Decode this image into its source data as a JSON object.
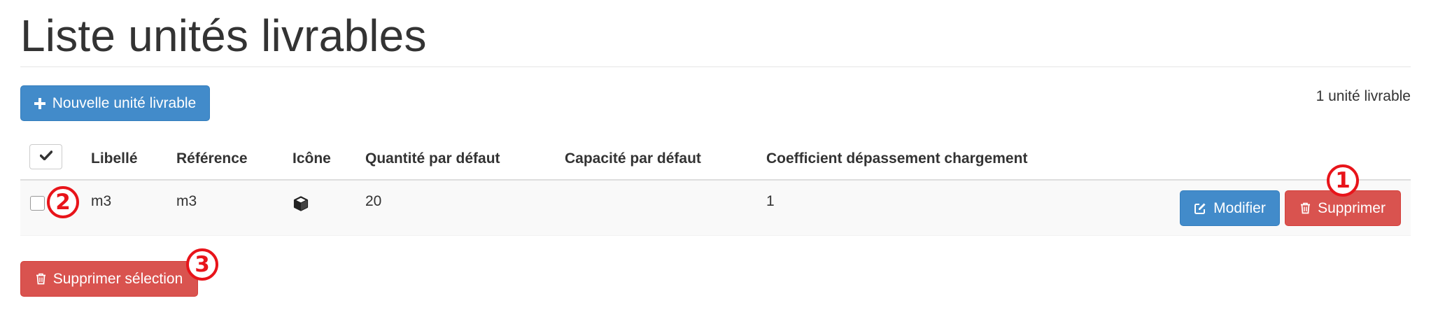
{
  "page": {
    "title": "Liste unités livrables",
    "count_text": "1 unité livrable"
  },
  "toolbar": {
    "new_label": "Nouvelle unité livrable",
    "new_icon": "plus-icon"
  },
  "table": {
    "columns": [
      "Libellé",
      "Référence",
      "Icône",
      "Quantité par défaut",
      "Capacité par défaut",
      "Coefficient dépassement chargement"
    ],
    "rows": [
      {
        "libelle": "m3",
        "reference": "m3",
        "icone": "cube-icon",
        "quantite": "20",
        "capacite": "",
        "coefficient": "1",
        "checked": false
      }
    ],
    "edit_label": "Modifier",
    "delete_label": "Supprimer"
  },
  "bulk": {
    "delete_selection_label": "Supprimer sélection"
  },
  "annotations": {
    "badge_1": "1",
    "badge_2": "2",
    "badge_3": "3"
  },
  "colors": {
    "primary": "#428bca",
    "danger": "#d9534f",
    "annotation": "#e8141a"
  }
}
